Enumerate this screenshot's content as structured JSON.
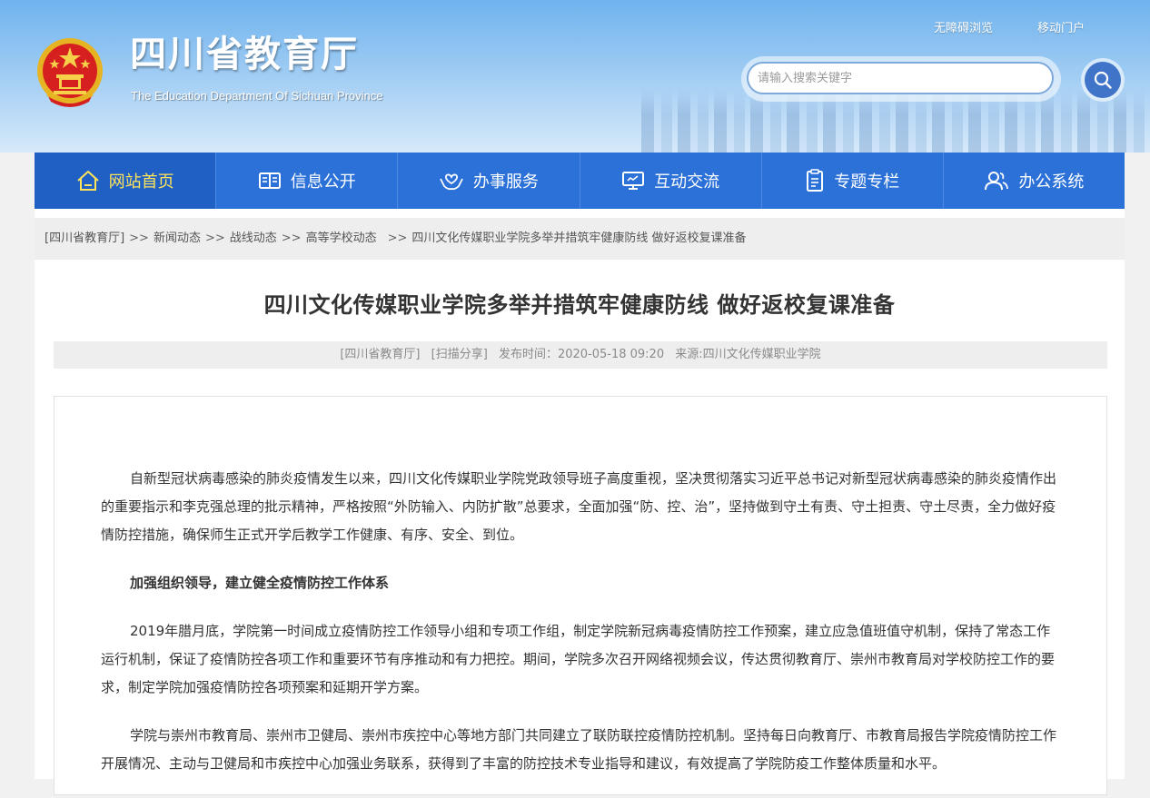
{
  "header": {
    "site_title": "四川省教育厅",
    "site_subtitle": "The Education Department Of Sichuan Province",
    "top_links": [
      "无障碍浏览",
      "移动门户"
    ],
    "search_placeholder": "请输入搜索关键字",
    "emblem_icon": "national-emblem-icon",
    "search_icon": "magnifier-icon"
  },
  "nav": {
    "items": [
      {
        "label": "网站首页",
        "icon": "home-icon",
        "active": true
      },
      {
        "label": "信息公开",
        "icon": "book-icon",
        "active": false
      },
      {
        "label": "办事服务",
        "icon": "hands-heart-icon",
        "active": false
      },
      {
        "label": "互动交流",
        "icon": "monitor-icon",
        "active": false
      },
      {
        "label": "专题专栏",
        "icon": "document-icon",
        "active": false
      },
      {
        "label": "办公系统",
        "icon": "users-icon",
        "active": false
      }
    ]
  },
  "breadcrumb": {
    "items": [
      "[四川省教育厅]",
      "新闻动态",
      "战线动态",
      "高等学校动态",
      "四川文化传媒职业学院多举并措筑牢健康防线 做好返校复课准备"
    ],
    "separator": ">>"
  },
  "article": {
    "title": "四川文化传媒职业学院多举并措筑牢健康防线 做好返校复课准备",
    "meta": {
      "site": "[四川省教育厅]",
      "share": "[扫描分享]",
      "publish_time": "发布时间：2020-05-18 09:20",
      "source": "来源:四川文化传媒职业学院"
    },
    "paragraphs": [
      "自新型冠状病毒感染的肺炎疫情发生以来，四川文化传媒职业学院党政领导班子高度重视，坚决贯彻落实习近平总书记对新型冠状病毒感染的肺炎疫情作出的重要指示和李克强总理的批示精神，严格按照“外防输入、内防扩散”总要求，全面加强“防、控、治”，坚持做到守土有责、守土担责、守土尽责，全力做好疫情防控措施，确保师生正式开学后教学工作健康、有序、安全、到位。",
      "加强组织领导，建立健全疫情防控工作体系",
      "2019年腊月底，学院第一时间成立疫情防控工作领导小组和专项工作组，制定学院新冠病毒疫情防控工作预案，建立应急值班值守机制，保持了常态工作运行机制，保证了疫情防控各项工作和重要环节有序推动和有力把控。期间，学院多次召开网络视频会议，传达贯彻教育厅、崇州市教育局对学校防控工作的要求，制定学院加强疫情防控各项预案和延期开学方案。",
      "学院与崇州市教育局、崇州市卫健局、崇州市疾控中心等地方部门共同建立了联防联控疫情防控机制。坚持每日向教育厅、市教育局报告学院疫情防控工作开展情况、主动与卫健局和市疾控中心加强业务联系，获得到了丰富的防控技术专业指导和建议，有效提高了学院防疫工作整体质量和水平。"
    ]
  },
  "colors": {
    "nav_bg": "#2b71d8",
    "nav_active_text": "#ffe35a",
    "title_text": "#333333",
    "meta_text": "#8a8a8a"
  }
}
